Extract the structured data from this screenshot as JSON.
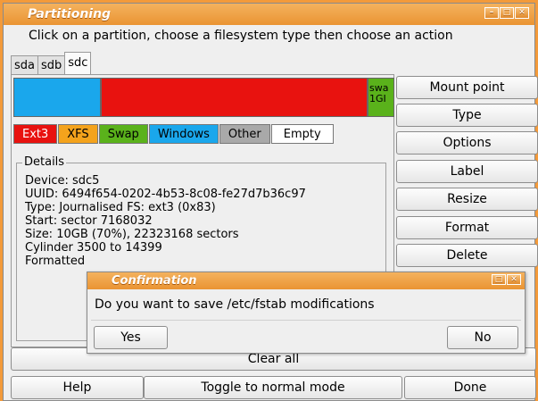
{
  "window": {
    "title": "Partitioning",
    "controls": [
      "minimize-icon",
      "maximize-icon",
      "close-icon"
    ]
  },
  "instruction": "Click on a partition, choose a filesystem type then choose an action",
  "tabs": [
    {
      "label": "sda",
      "active": false
    },
    {
      "label": "sdb",
      "active": false
    },
    {
      "label": "sdc",
      "active": true
    }
  ],
  "partitions": [
    {
      "label": "",
      "type": "Windows",
      "color": "#1aa7ec"
    },
    {
      "label": "",
      "type": "Ext3",
      "color": "#e8120f"
    },
    {
      "label": "swa\n1GI",
      "type": "Swap",
      "color": "#5ab21b"
    }
  ],
  "legend": [
    {
      "label": "Ext3",
      "color": "#e8120f",
      "text_color": "#ffffff"
    },
    {
      "label": "XFS",
      "color": "#f4a31c",
      "text_color": "#000000"
    },
    {
      "label": "Swap",
      "color": "#5ab21b",
      "text_color": "#000000"
    },
    {
      "label": "Windows",
      "color": "#1aa7ec",
      "text_color": "#000000"
    },
    {
      "label": "Other",
      "color": "#a9a9a9",
      "text_color": "#000000"
    },
    {
      "label": "Empty",
      "color": "#ffffff",
      "text_color": "#000000"
    }
  ],
  "details": {
    "heading": "Details",
    "lines": [
      "Device: sdc5",
      "UUID: 6494f654-0202-4b53-8c08-fe27d7b36c97",
      "Type: Journalised FS: ext3 (0x83)",
      "Start: sector 7168032",
      "Size: 10GB (70%), 22323168 sectors",
      "Cylinder 3500 to 14399",
      "Formatted"
    ]
  },
  "actions": {
    "mount_point": "Mount point",
    "type": "Type",
    "options": "Options",
    "label": "Label",
    "resize": "Resize",
    "format": "Format",
    "delete": "Delete"
  },
  "clear_all": "Clear all",
  "footer": {
    "help": "Help",
    "toggle": "Toggle to normal mode",
    "done": "Done"
  },
  "dialog": {
    "title": "Confirmation",
    "message": "Do you want to save /etc/fstab modifications",
    "yes": "Yes",
    "no": "No"
  }
}
